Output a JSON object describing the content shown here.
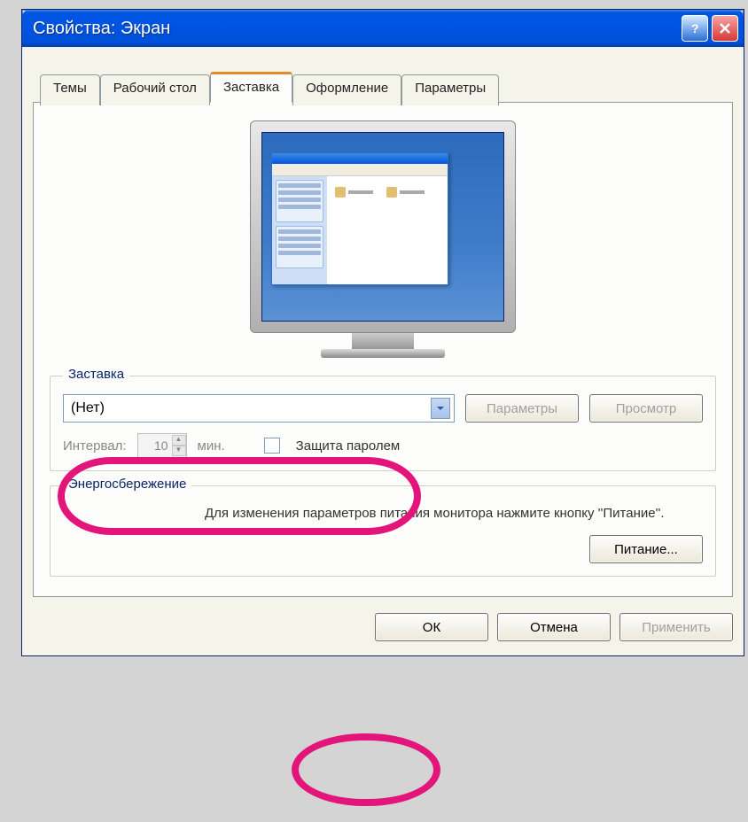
{
  "window": {
    "title": "Свойства: Экран"
  },
  "tabs": [
    {
      "label": "Темы"
    },
    {
      "label": "Рабочий стол"
    },
    {
      "label": "Заставка"
    },
    {
      "label": "Оформление"
    },
    {
      "label": "Параметры"
    }
  ],
  "active_tab_index": 2,
  "screensaver": {
    "group_label": "Заставка",
    "selected": "(Нет)",
    "settings_btn": "Параметры",
    "preview_btn": "Просмотр",
    "interval_label": "Интервал:",
    "interval_value": "10",
    "interval_unit": "мин.",
    "password_check": "Защита паролем"
  },
  "power": {
    "group_label": "Энергосбережение",
    "description": "Для изменения параметров питания монитора нажмите кнопку ''Питание''.",
    "button": "Питание..."
  },
  "buttons": {
    "ok": "ОК",
    "cancel": "Отмена",
    "apply": "Применить"
  }
}
